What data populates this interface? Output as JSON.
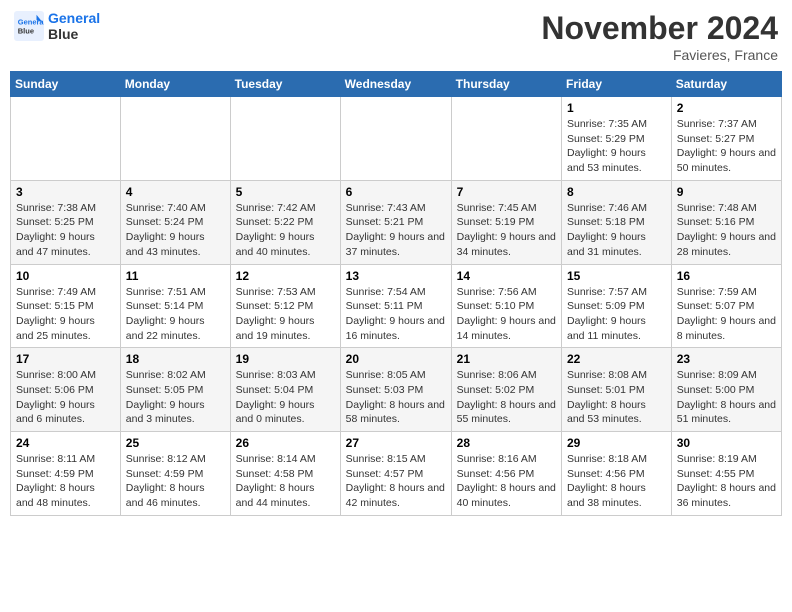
{
  "header": {
    "logo_line1": "General",
    "logo_line2": "Blue",
    "month_title": "November 2024",
    "location": "Favieres, France"
  },
  "weekdays": [
    "Sunday",
    "Monday",
    "Tuesday",
    "Wednesday",
    "Thursday",
    "Friday",
    "Saturday"
  ],
  "weeks": [
    [
      {
        "day": "",
        "info": ""
      },
      {
        "day": "",
        "info": ""
      },
      {
        "day": "",
        "info": ""
      },
      {
        "day": "",
        "info": ""
      },
      {
        "day": "",
        "info": ""
      },
      {
        "day": "1",
        "info": "Sunrise: 7:35 AM\nSunset: 5:29 PM\nDaylight: 9 hours and 53 minutes."
      },
      {
        "day": "2",
        "info": "Sunrise: 7:37 AM\nSunset: 5:27 PM\nDaylight: 9 hours and 50 minutes."
      }
    ],
    [
      {
        "day": "3",
        "info": "Sunrise: 7:38 AM\nSunset: 5:25 PM\nDaylight: 9 hours and 47 minutes."
      },
      {
        "day": "4",
        "info": "Sunrise: 7:40 AM\nSunset: 5:24 PM\nDaylight: 9 hours and 43 minutes."
      },
      {
        "day": "5",
        "info": "Sunrise: 7:42 AM\nSunset: 5:22 PM\nDaylight: 9 hours and 40 minutes."
      },
      {
        "day": "6",
        "info": "Sunrise: 7:43 AM\nSunset: 5:21 PM\nDaylight: 9 hours and 37 minutes."
      },
      {
        "day": "7",
        "info": "Sunrise: 7:45 AM\nSunset: 5:19 PM\nDaylight: 9 hours and 34 minutes."
      },
      {
        "day": "8",
        "info": "Sunrise: 7:46 AM\nSunset: 5:18 PM\nDaylight: 9 hours and 31 minutes."
      },
      {
        "day": "9",
        "info": "Sunrise: 7:48 AM\nSunset: 5:16 PM\nDaylight: 9 hours and 28 minutes."
      }
    ],
    [
      {
        "day": "10",
        "info": "Sunrise: 7:49 AM\nSunset: 5:15 PM\nDaylight: 9 hours and 25 minutes."
      },
      {
        "day": "11",
        "info": "Sunrise: 7:51 AM\nSunset: 5:14 PM\nDaylight: 9 hours and 22 minutes."
      },
      {
        "day": "12",
        "info": "Sunrise: 7:53 AM\nSunset: 5:12 PM\nDaylight: 9 hours and 19 minutes."
      },
      {
        "day": "13",
        "info": "Sunrise: 7:54 AM\nSunset: 5:11 PM\nDaylight: 9 hours and 16 minutes."
      },
      {
        "day": "14",
        "info": "Sunrise: 7:56 AM\nSunset: 5:10 PM\nDaylight: 9 hours and 14 minutes."
      },
      {
        "day": "15",
        "info": "Sunrise: 7:57 AM\nSunset: 5:09 PM\nDaylight: 9 hours and 11 minutes."
      },
      {
        "day": "16",
        "info": "Sunrise: 7:59 AM\nSunset: 5:07 PM\nDaylight: 9 hours and 8 minutes."
      }
    ],
    [
      {
        "day": "17",
        "info": "Sunrise: 8:00 AM\nSunset: 5:06 PM\nDaylight: 9 hours and 6 minutes."
      },
      {
        "day": "18",
        "info": "Sunrise: 8:02 AM\nSunset: 5:05 PM\nDaylight: 9 hours and 3 minutes."
      },
      {
        "day": "19",
        "info": "Sunrise: 8:03 AM\nSunset: 5:04 PM\nDaylight: 9 hours and 0 minutes."
      },
      {
        "day": "20",
        "info": "Sunrise: 8:05 AM\nSunset: 5:03 PM\nDaylight: 8 hours and 58 minutes."
      },
      {
        "day": "21",
        "info": "Sunrise: 8:06 AM\nSunset: 5:02 PM\nDaylight: 8 hours and 55 minutes."
      },
      {
        "day": "22",
        "info": "Sunrise: 8:08 AM\nSunset: 5:01 PM\nDaylight: 8 hours and 53 minutes."
      },
      {
        "day": "23",
        "info": "Sunrise: 8:09 AM\nSunset: 5:00 PM\nDaylight: 8 hours and 51 minutes."
      }
    ],
    [
      {
        "day": "24",
        "info": "Sunrise: 8:11 AM\nSunset: 4:59 PM\nDaylight: 8 hours and 48 minutes."
      },
      {
        "day": "25",
        "info": "Sunrise: 8:12 AM\nSunset: 4:59 PM\nDaylight: 8 hours and 46 minutes."
      },
      {
        "day": "26",
        "info": "Sunrise: 8:14 AM\nSunset: 4:58 PM\nDaylight: 8 hours and 44 minutes."
      },
      {
        "day": "27",
        "info": "Sunrise: 8:15 AM\nSunset: 4:57 PM\nDaylight: 8 hours and 42 minutes."
      },
      {
        "day": "28",
        "info": "Sunrise: 8:16 AM\nSunset: 4:56 PM\nDaylight: 8 hours and 40 minutes."
      },
      {
        "day": "29",
        "info": "Sunrise: 8:18 AM\nSunset: 4:56 PM\nDaylight: 8 hours and 38 minutes."
      },
      {
        "day": "30",
        "info": "Sunrise: 8:19 AM\nSunset: 4:55 PM\nDaylight: 8 hours and 36 minutes."
      }
    ]
  ]
}
